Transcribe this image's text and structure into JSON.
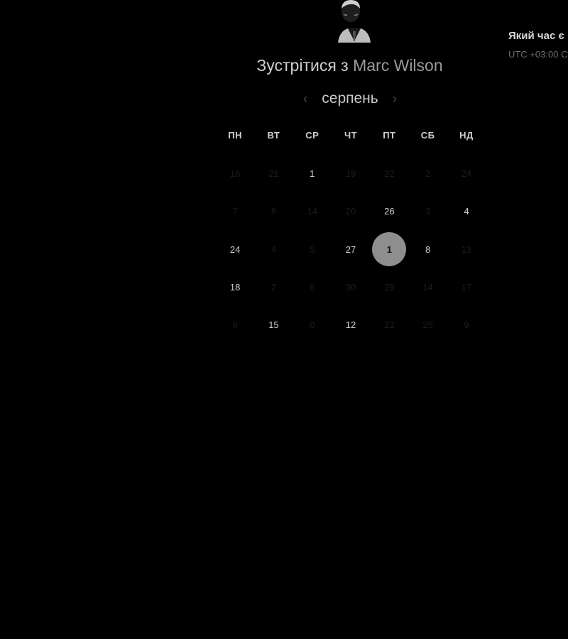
{
  "booking": {
    "title_prefix": "Зустрітися з",
    "host_name": "Marc Wilson"
  },
  "calendar": {
    "month": "серпень",
    "prev_icon": "chevron-left-icon",
    "next_icon": "chevron-right-icon",
    "weekdays": [
      "ПН",
      "ВТ",
      "СР",
      "ЧТ",
      "ПТ",
      "СБ",
      "НД"
    ],
    "rows": [
      [
        {
          "d": "16",
          "a": false
        },
        {
          "d": "21",
          "a": false
        },
        {
          "d": "1",
          "a": true
        },
        {
          "d": "19",
          "a": false
        },
        {
          "d": "22",
          "a": false
        },
        {
          "d": "2",
          "a": false
        },
        {
          "d": "24",
          "a": false
        }
      ],
      [
        {
          "d": "7",
          "a": false
        },
        {
          "d": "8",
          "a": false
        },
        {
          "d": "14",
          "a": false
        },
        {
          "d": "20",
          "a": false
        },
        {
          "d": "26",
          "a": true
        },
        {
          "d": "3",
          "a": false
        },
        {
          "d": "4",
          "a": true
        }
      ],
      [
        {
          "d": "24",
          "a": true
        },
        {
          "d": "4",
          "a": false
        },
        {
          "d": "5",
          "a": false
        },
        {
          "d": "27",
          "a": true
        },
        {
          "d": "1",
          "a": true,
          "s": true
        },
        {
          "d": "8",
          "a": true
        },
        {
          "d": "13",
          "a": false
        }
      ],
      [
        {
          "d": "18",
          "a": true
        },
        {
          "d": "2",
          "a": false
        },
        {
          "d": "6",
          "a": false
        },
        {
          "d": "30",
          "a": false
        },
        {
          "d": "29",
          "a": false
        },
        {
          "d": "14",
          "a": false
        },
        {
          "d": "17",
          "a": false
        }
      ],
      [
        {
          "d": "9",
          "a": false
        },
        {
          "d": "15",
          "a": true
        },
        {
          "d": "0",
          "a": false
        },
        {
          "d": "12",
          "a": true
        },
        {
          "d": "22",
          "a": false
        },
        {
          "d": "25",
          "a": false
        },
        {
          "d": "9",
          "a": false
        }
      ]
    ]
  },
  "timezone": {
    "title": "Який час є",
    "offset": "UTC +03:00 С"
  },
  "colors": {
    "background": "#000000",
    "selected_day": "#8e8e8e",
    "text": "#d0d0d0"
  }
}
